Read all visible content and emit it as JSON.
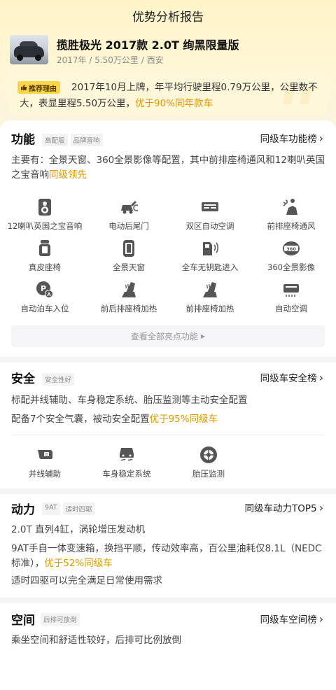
{
  "header": {
    "title": "优势分析报告"
  },
  "car": {
    "name": "揽胜极光 2017款 2.0T 绚黑限量版",
    "meta": "2017年 / 5.50万公里 / 西安"
  },
  "recommend": {
    "badge": "推荐理由",
    "text_plain": "2017年10月上牌，年平均行驶里程0.79万公里，公里数不大，表显里程5.50万公里，",
    "text_highlight": "优于90%同年款车"
  },
  "features": {
    "title": "功能",
    "tags": [
      "高配版",
      "品牌音响"
    ],
    "rank_link": "同级车功能榜",
    "desc_plain": "主要有：全景天窗、360全景影像等配置，其中前排座椅通风和12喇叭英国之宝音响",
    "desc_highlight": "同级领先",
    "items": [
      {
        "label": "12喇叭英国之宝音响",
        "icon": "speaker-icon"
      },
      {
        "label": "电动后尾门",
        "icon": "power-tailgate-icon"
      },
      {
        "label": "双区自动空调",
        "icon": "dual-zone-ac-icon"
      },
      {
        "label": "前排座椅通风",
        "icon": "seat-ventilation-icon"
      },
      {
        "label": "真皮座椅",
        "icon": "leather-seat-icon"
      },
      {
        "label": "全景天窗",
        "icon": "panoramic-sunroof-icon"
      },
      {
        "label": "全车无钥匙进入",
        "icon": "keyless-entry-icon"
      },
      {
        "label": "360全景影像",
        "icon": "360-camera-icon"
      },
      {
        "label": "自动泊车入位",
        "icon": "auto-parking-icon"
      },
      {
        "label": "前后排座椅加热",
        "icon": "seat-heating-icon"
      },
      {
        "label": "前排座椅加热",
        "icon": "front-seat-heating-icon"
      },
      {
        "label": "自动空调",
        "icon": "auto-ac-icon"
      }
    ],
    "view_all": "查看全部亮点功能"
  },
  "safety": {
    "title": "安全",
    "tags": [
      "安全性好"
    ],
    "rank_link": "同级车安全榜",
    "line1": "标配并线辅助、车身稳定系统、胎压监测等主动安全配置",
    "line2_plain": "配备7个安全气囊，被动安全配置",
    "line2_highlight": "优于95%同级车",
    "items": [
      {
        "label": "并线辅助",
        "icon": "lane-change-assist-icon"
      },
      {
        "label": "车身稳定系统",
        "icon": "stability-control-icon"
      },
      {
        "label": "胎压监测",
        "icon": "tire-pressure-icon"
      }
    ]
  },
  "power": {
    "title": "动力",
    "tags": [
      "9AT",
      "适时四驱"
    ],
    "rank_link": "同级车动力TOP5",
    "line1": "2.0T 直列4缸，涡轮增压发动机",
    "line2_plain": "9AT手自一体变速箱，换挡平顺，传动效率高，百公里油耗仅8.1L（NEDC标准），",
    "line2_highlight": "优于52%同级车",
    "line3": "适时四驱可以完全满足日常使用需求"
  },
  "space": {
    "title": "空间",
    "tags": [
      "后排可放倒"
    ],
    "rank_link": "同级车空间榜",
    "line1": "乘坐空间和舒适性较好，后排可比例放倒"
  },
  "colors": {
    "accent": "#d99a00",
    "badge": "#fbd54a",
    "hero": "#fff4c8"
  }
}
